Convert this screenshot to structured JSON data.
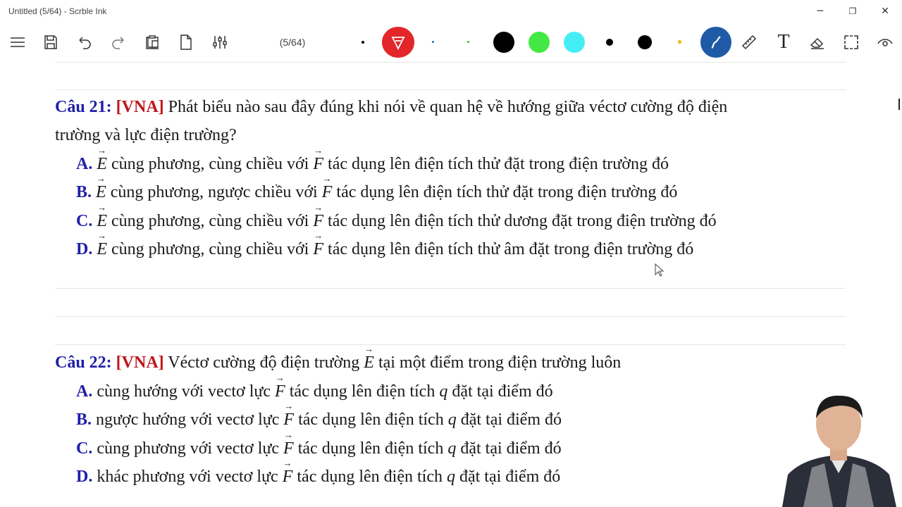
{
  "window": {
    "title": "Untitled (5/64) - Scrble Ink",
    "minimize": "─",
    "restore": "❐",
    "close": "✕"
  },
  "toolbar": {
    "page_indicator": "(5/64)",
    "icons": [
      "menu-icon",
      "save-icon",
      "undo-icon",
      "redo-icon",
      "paste-icon",
      "new-page-icon",
      "settings-sliders-icon",
      "pen-icon",
      "ruler-icon",
      "text-icon",
      "eraser-icon",
      "select-icon",
      "view-icon"
    ],
    "text_tool": "T",
    "colors": {
      "red_active": "#e3262a",
      "blue_dot": "#3060d0",
      "green_dot": "#30c030",
      "black": "#000000",
      "green": "#44e844",
      "cyan": "#44eef4",
      "yellow_dot": "#e6b800",
      "pen_active": "#1f5aa6"
    }
  },
  "q21": {
    "label": "Câu 21:",
    "tag": "[VNA]",
    "line1": "Phát biểu nào sau đây đúng khi nói về quan hệ về hướng giữa véctơ cường độ điện",
    "line2": "trường và lực điện trường?",
    "options": [
      {
        "label": "A.",
        "pre": "E",
        "mid": "cùng phương, cùng chiều với",
        "vec": "F",
        "post": "tác dụng lên điện tích thử đặt trong điện trường đó"
      },
      {
        "label": "B.",
        "pre": "E",
        "mid": "cùng phương, ngược chiều với",
        "vec": "F",
        "post": "tác dụng lên điện tích thử đặt trong điện trường đó"
      },
      {
        "label": "C.",
        "pre": "E",
        "mid": "cùng phương, cùng chiều với",
        "vec": "F",
        "post": "tác dụng lên điện tích thử dương đặt trong điện trường đó"
      },
      {
        "label": "D.",
        "pre": "E",
        "mid": "cùng phương, cùng chiều với",
        "vec": "F",
        "post": "tác dụng lên điện tích thử âm đặt trong điện trường đó"
      }
    ]
  },
  "q22": {
    "label": "Câu 22:",
    "tag": "[VNA]",
    "line1_a": "Véctơ cường độ điện trường",
    "line1_vec": "E",
    "line1_b": "tại một điểm trong điện trường luôn",
    "options": [
      {
        "label": "A.",
        "mid": "cùng hướng với vectơ lực",
        "vec": "F",
        "post_a": "tác dụng lên điện tích",
        "var": "q",
        "post_b": "đặt tại điểm đó"
      },
      {
        "label": "B.",
        "mid": "ngược hướng với vectơ lực",
        "vec": "F",
        "post_a": "tác dụng lên điện tích",
        "var": "q",
        "post_b": "đặt tại điểm đó"
      },
      {
        "label": "C.",
        "mid": "cùng phương với vectơ lực",
        "vec": "F",
        "post_a": "tác dụng lên điện tích",
        "var": "q",
        "post_b": "đặt tại điểm đó"
      },
      {
        "label": "D.",
        "mid": "khác phương với vectơ lực",
        "vec": "F",
        "post_a": "tác dụng lên điện tích",
        "var": "q",
        "post_b": "đặt tại điểm đó"
      }
    ]
  }
}
